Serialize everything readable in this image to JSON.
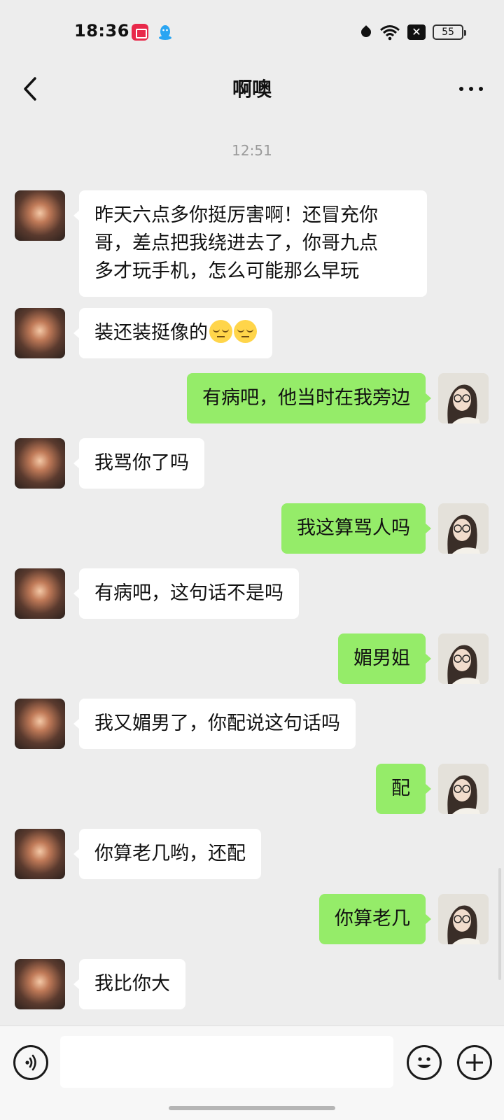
{
  "status_bar": {
    "time": "18:36",
    "battery": "55",
    "icons": [
      "screen-record-icon",
      "qq-icon",
      "data-drop-icon",
      "wifi-icon",
      "x-box-icon",
      "battery-icon"
    ]
  },
  "header": {
    "title": "啊噢"
  },
  "timestamp": "12:51",
  "messages": [
    {
      "side": "left",
      "text": "昨天六点多你挺厉害啊！还冒充你\n哥，差点把我绕进去了，你哥九点\n多才玩手机，怎么可能那么早玩"
    },
    {
      "side": "left",
      "text": "装还装挺像的",
      "emoji_count": 2
    },
    {
      "side": "right",
      "text": "有病吧，他当时在我旁边"
    },
    {
      "side": "left",
      "text": "我骂你了吗"
    },
    {
      "side": "right",
      "text": "我这算骂人吗"
    },
    {
      "side": "left",
      "text": "有病吧，这句话不是吗"
    },
    {
      "side": "right",
      "text": "媚男姐"
    },
    {
      "side": "left",
      "text": "我又媚男了，你配说这句话吗"
    },
    {
      "side": "right",
      "text": "配"
    },
    {
      "side": "left",
      "text": "你算老几哟，还配"
    },
    {
      "side": "right",
      "text": "你算老几"
    },
    {
      "side": "left",
      "text": "我比你大"
    }
  ],
  "input": {
    "value": "",
    "placeholder": ""
  },
  "colors": {
    "background": "#ededed",
    "my_bubble": "#95ec69",
    "their_bubble": "#ffffff"
  }
}
